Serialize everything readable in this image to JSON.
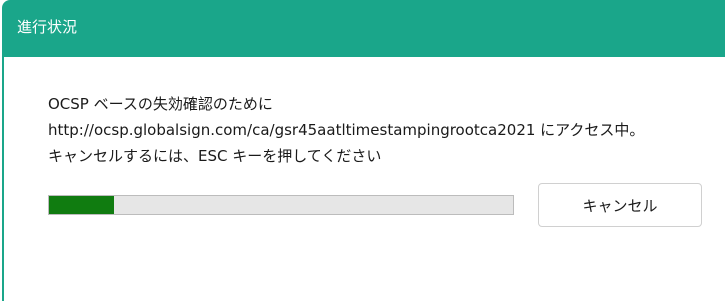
{
  "window": {
    "title": "進行状況",
    "accent_color": "#1aa68a"
  },
  "message": {
    "line1": "OCSP ベースの失効確認のために",
    "line2": "http://ocsp.globalsign.com/ca/gsr45aatltimestampingrootca2021 にアクセス中。",
    "line3": "キャンセルするには、ESC キーを押してください"
  },
  "progress": {
    "fraction": 0.14,
    "fill_color": "#107c10"
  },
  "buttons": {
    "cancel_label": "キャンセル"
  }
}
